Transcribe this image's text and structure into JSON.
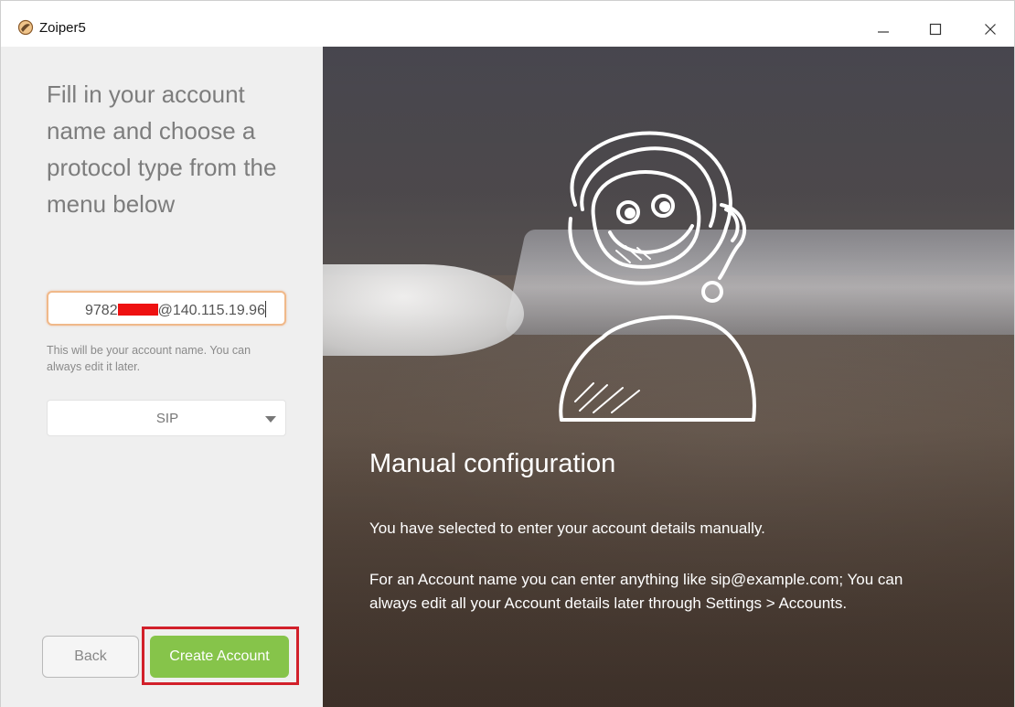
{
  "window": {
    "title": "Zoiper5"
  },
  "left": {
    "heading": "Fill in your account name and choose a protocol type from the menu below",
    "account_prefix": "9782",
    "account_suffix": "@140.115.19.96",
    "hint": "This will be your account name. You can always edit it later.",
    "protocol": "SIP",
    "back_label": "Back",
    "create_label": "Create Account"
  },
  "right": {
    "title": "Manual configuration",
    "p1": "You have selected to enter your account details manually.",
    "p2": "For an Account name you can enter anything like sip@example.com; You can always edit all your Account details later through Settings > Accounts."
  },
  "colors": {
    "accent_green": "#86c44a",
    "input_focus": "#f0b98a",
    "highlight_red": "#d2202a"
  },
  "icons": [
    "app-logo-icon",
    "minimize-icon",
    "maximize-icon",
    "close-icon",
    "dropdown-arrow-icon",
    "mascot-illustration"
  ]
}
